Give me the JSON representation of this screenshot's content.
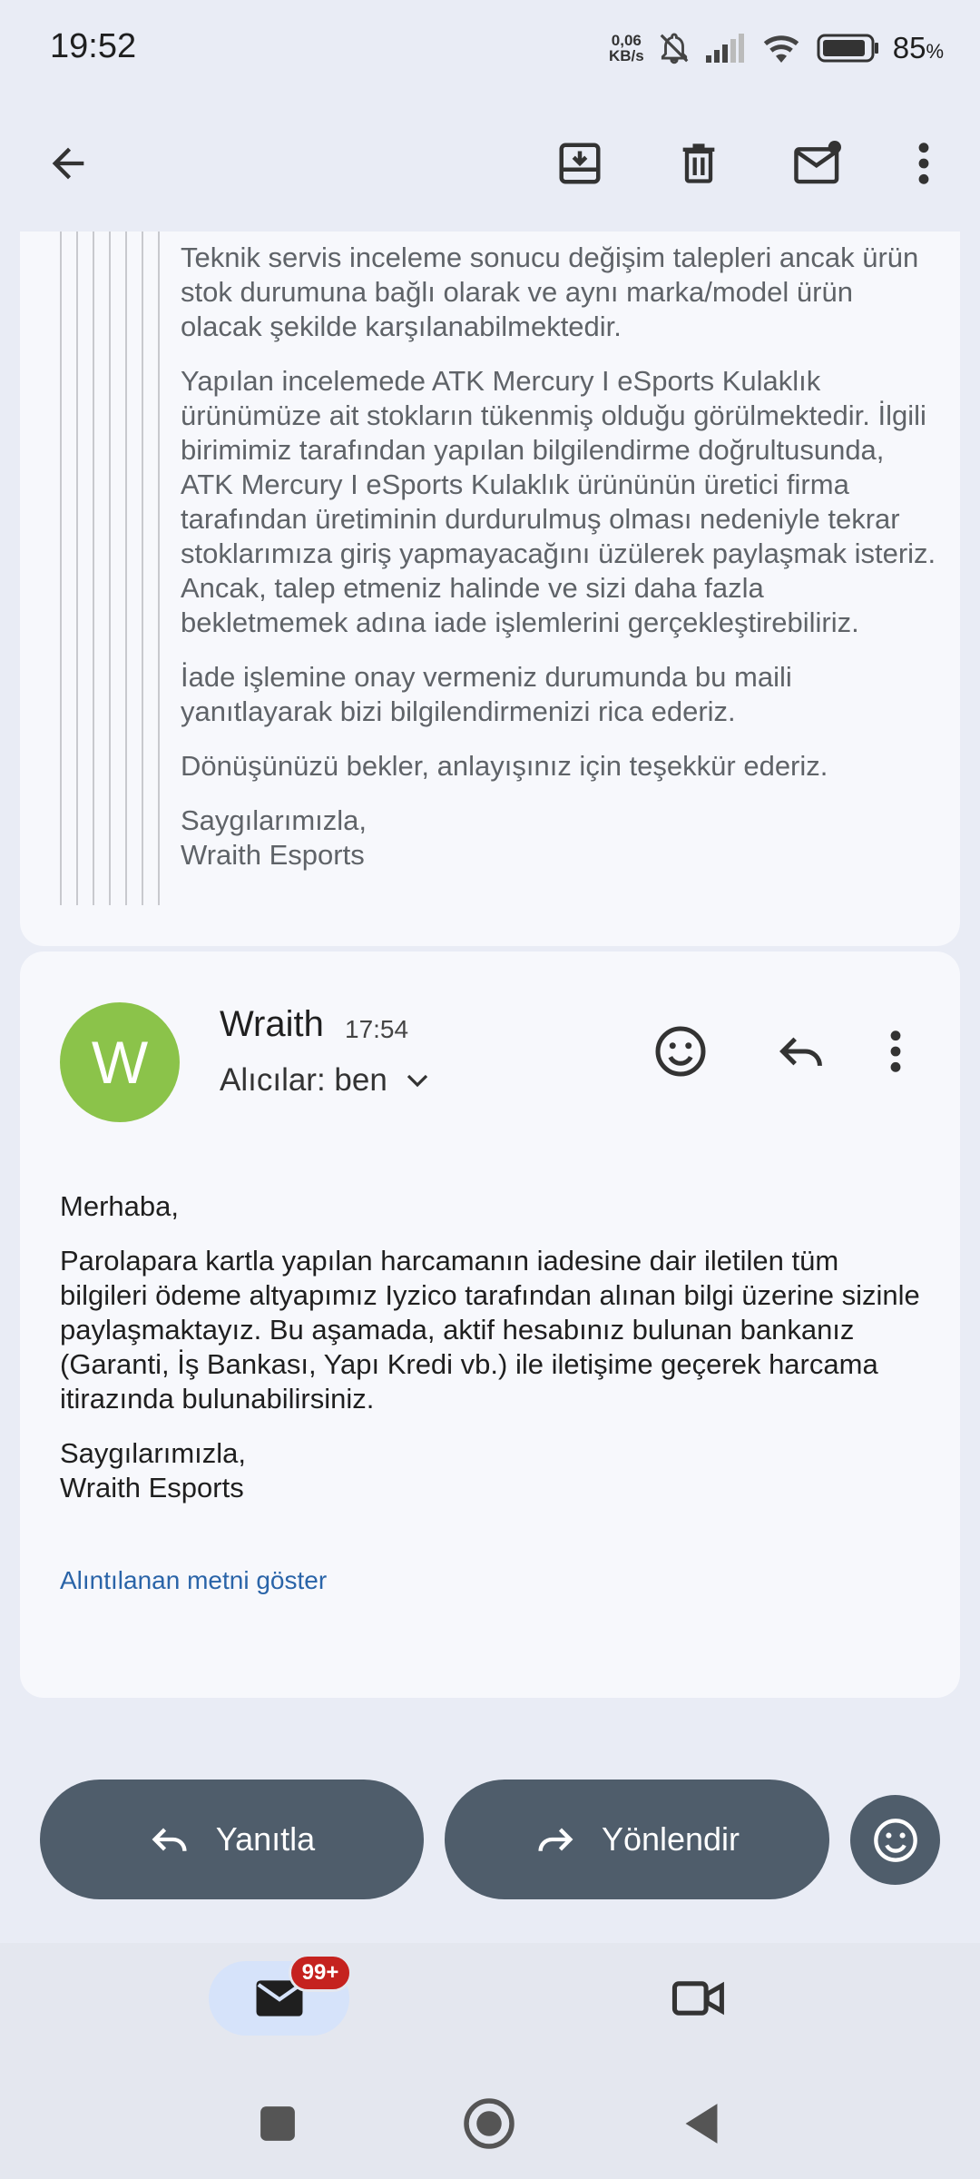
{
  "status_bar": {
    "time": "19:52",
    "net_speed_value": "0,06",
    "net_speed_unit": "KB/s",
    "battery_percent": "85",
    "battery_suffix": "%",
    "icons": [
      "mute-bell-icon",
      "signal-icon",
      "wifi-icon",
      "battery-icon"
    ]
  },
  "toolbar": {
    "icons": [
      "back-arrow-icon",
      "archive-icon",
      "delete-icon",
      "mark-unread-icon",
      "more-vert-icon"
    ]
  },
  "quoted_message": {
    "paragraphs": [
      "Teknik servis inceleme sonucu değişim talepleri ancak ürün stok durumuna bağlı olarak ve aynı marka/model ürün olacak şekilde karşılanabilmektedir.",
      "Yapılan incelemede ATK Mercury I eSports Kulaklık ürünümüze ait stokların tükenmiş olduğu görülmektedir. İlgili birimimiz tarafından yapılan bilgilendirme doğrultusunda, ATK Mercury I eSports Kulaklık ürününün üretici firma tarafından üretiminin durdurulmuş olması nedeniyle tekrar stoklarımıza giriş yapmayacağını üzülerek paylaşmak isteriz. Ancak, talep etmeniz halinde ve sizi daha fazla bekletmemek adına iade işlemlerini gerçekleştirebiliriz.",
      "İade işlemine onay vermeniz durumunda bu maili yanıtlayarak bizi bilgilendirmenizi rica ederiz.",
      "Dönüşünüzü bekler, anlayışınız için teşekkür ederiz."
    ],
    "signoff_line1": "Saygılarımızla,",
    "signoff_line2": "Wraith Esports"
  },
  "message": {
    "avatar_letter": "W",
    "avatar_color": "#8bc34a",
    "sender": "Wraith",
    "time": "17:54",
    "recipients": "Alıcılar: ben",
    "greeting": "Merhaba,",
    "body": "Parolapara kartla yapılan harcamanın iadesine dair iletilen tüm bilgileri ödeme altyapımız Iyzico tarafından alınan bilgi üzerine sizinle paylaşmaktayız. Bu aşamada, aktif hesabınız bulunan bankanız (Garanti, İş Bankası, Yapı Kredi vb.) ile iletişime geçerek harcama itirazında bulunabilirsiniz.",
    "signoff_line1": "Saygılarımızla,",
    "signoff_line2": "Wraith Esports",
    "show_quoted": "Alıntılanan metni göster"
  },
  "actions": {
    "reply": "Yanıtla",
    "forward": "Yönlendir"
  },
  "bottom_nav": {
    "mail_badge": "99+",
    "accent": "#d6e3fa",
    "badge_color": "#c5221f"
  }
}
